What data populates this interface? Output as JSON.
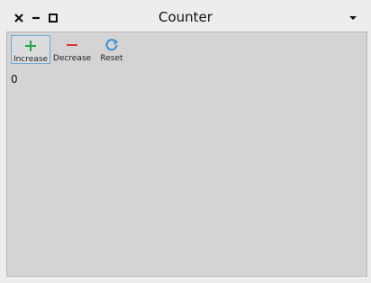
{
  "window": {
    "title": "Counter"
  },
  "toolbar": {
    "increase_label": "Increase",
    "decrease_label": "Decrease",
    "reset_label": "Reset"
  },
  "counter": {
    "value": "0"
  },
  "icons": {
    "increase": "plus-icon",
    "decrease": "minus-icon",
    "reset": "refresh-icon"
  },
  "colors": {
    "increase": "#1fa84a",
    "decrease": "#e0342b",
    "reset": "#3a8fd0",
    "window_bg": "#ededed",
    "content_bg": "#d4d4d4",
    "active_border": "#6aa9d6"
  }
}
